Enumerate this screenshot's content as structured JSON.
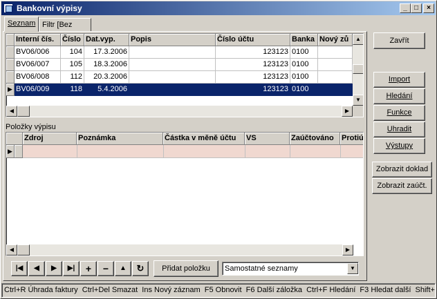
{
  "window": {
    "title": "Bankovní výpisy"
  },
  "tabs": [
    {
      "label": "Seznam",
      "active": true
    },
    {
      "label": "Filtr [Bez filtru]",
      "active": false
    }
  ],
  "statements": {
    "columns": [
      "Interní čís.",
      "Číslo",
      "Dat.vyp.",
      "Popis",
      "Číslo účtu",
      "Banka",
      "Nový zů"
    ],
    "rows": [
      {
        "interni": "BV06/006",
        "cislo": "104",
        "datum": "17.3.2006",
        "popis": "",
        "ucet": "123123",
        "banka": "0100",
        "novy": "",
        "selected": false
      },
      {
        "interni": "BV06/007",
        "cislo": "105",
        "datum": "18.3.2006",
        "popis": "",
        "ucet": "123123",
        "banka": "0100",
        "novy": "",
        "selected": false
      },
      {
        "interni": "BV06/008",
        "cislo": "112",
        "datum": "20.3.2006",
        "popis": "",
        "ucet": "123123",
        "banka": "0100",
        "novy": "",
        "selected": false
      },
      {
        "interni": "BV06/009",
        "cislo": "118",
        "datum": "5.4.2006",
        "popis": "",
        "ucet": "123123",
        "banka": "0100",
        "novy": "",
        "selected": true
      }
    ]
  },
  "items": {
    "label": "Položky výpisu",
    "columns": [
      "Zdroj",
      "Poznámka",
      "Částka v měně účtu",
      "VS",
      "Zaúčtováno",
      "Protiú"
    ]
  },
  "side_buttons": {
    "close": "Zavřít",
    "import": "Import",
    "search": "Hledání",
    "functions": "Funkce",
    "pay": "Uhradit",
    "outputs": "Výstupy",
    "show_doc": "Zobrazit doklad",
    "show_acc": "Zobrazit zaúčt."
  },
  "bottom": {
    "add_item": "Přidat položku",
    "dropdown_value": "Samostatné seznamy"
  },
  "nav_icons": [
    "first-icon",
    "prev-icon",
    "next-icon",
    "last-icon",
    "add-icon",
    "delete-icon",
    "up-icon",
    "refresh-icon"
  ],
  "status_bar": "Ctrl+R Úhrada faktury  Ctrl+Del Smazat  Ins Nový záznam  F5 Obnovit  F6 Další záložka  Ctrl+F Hledání  F3 Hledat další  Shift+"
}
